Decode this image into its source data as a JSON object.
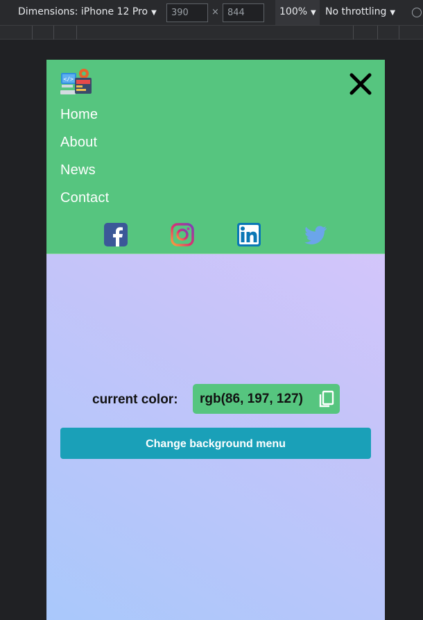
{
  "devtools": {
    "dimensions_label": "Dimensions: iPhone 12 Pro",
    "width": "390",
    "x_sign": "×",
    "height": "844",
    "zoom": "100%",
    "throttling": "No throttling",
    "caret": "▼"
  },
  "menu": {
    "background": "#56c57f",
    "nav": [
      "Home",
      "About",
      "News",
      "Contact"
    ],
    "social_icons": [
      "facebook-icon",
      "instagram-icon",
      "linkedin-icon",
      "twitter-icon"
    ]
  },
  "color_panel": {
    "label": "current color:",
    "value": "rgb(86, 197, 127)"
  },
  "button": {
    "label": "Change background menu",
    "color": "#1aa0b8"
  }
}
